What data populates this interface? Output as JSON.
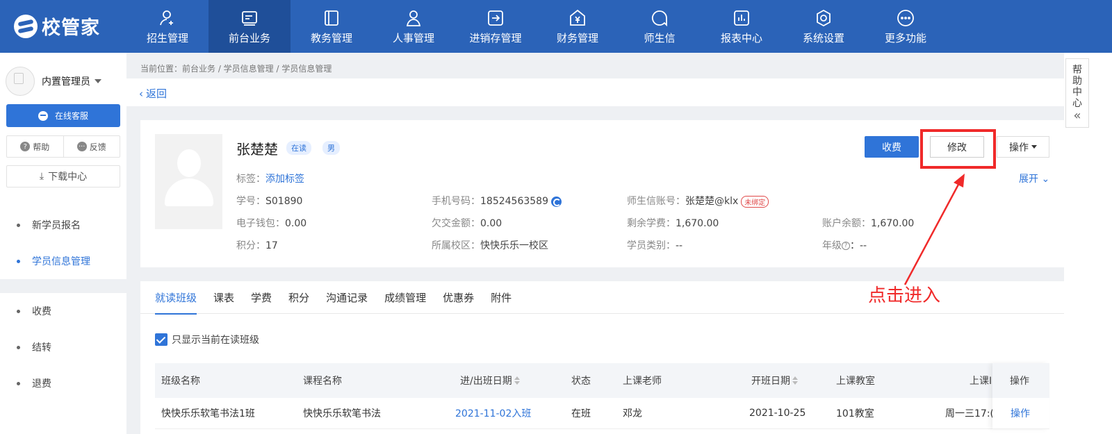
{
  "brand": {
    "name": "校管家"
  },
  "nav": [
    {
      "label": "招生管理",
      "icon": "user-add-icon"
    },
    {
      "label": "前台业务",
      "icon": "desk-icon"
    },
    {
      "label": "教务管理",
      "icon": "book-icon"
    },
    {
      "label": "人事管理",
      "icon": "person-icon"
    },
    {
      "label": "进销存管理",
      "icon": "inventory-icon"
    },
    {
      "label": "财务管理",
      "icon": "finance-icon"
    },
    {
      "label": "师生信",
      "icon": "chat-icon"
    },
    {
      "label": "报表中心",
      "icon": "report-icon"
    },
    {
      "label": "系统设置",
      "icon": "settings-icon"
    },
    {
      "label": "更多功能",
      "icon": "more-icon"
    }
  ],
  "sidebar": {
    "user": "内置管理员",
    "online_service": "在线客服",
    "help": "帮助",
    "feedback": "反馈",
    "download": "下载中心",
    "items": [
      {
        "label": "新学员报名"
      },
      {
        "label": "学员信息管理"
      },
      {
        "label": "收费"
      },
      {
        "label": "结转"
      },
      {
        "label": "退费"
      }
    ]
  },
  "breadcrumb": "当前位置：前台业务 / 学员信息管理 / 学员信息管理",
  "back": "返回",
  "student": {
    "name": "张楚楚",
    "status": "在读",
    "gender": "男",
    "tag_label": "标签：",
    "tag_link": "添加标签",
    "fields": {
      "id_label": "学号：",
      "id": "S01890",
      "phone_label": "手机号码：",
      "phone": "18524563589",
      "account_label": "师生信账号：",
      "account": "张楚楚@klx",
      "unbound": "未绑定",
      "wallet_label": "电子钱包：",
      "wallet": "0.00",
      "owed_label": "欠交金额：",
      "owed": "0.00",
      "remain_label": "剩余学费：",
      "remain": "1,670.00",
      "balance_label": "账户余额：",
      "balance": "1,670.00",
      "points_label": "积分：",
      "points": "17",
      "campus_label": "所属校区：",
      "campus": "快快乐乐一校区",
      "category_label": "学员类别：",
      "category": "--",
      "grade_label": "年级",
      "grade": "：--"
    },
    "buttons": {
      "pay": "收费",
      "edit": "修改",
      "ops": "操作",
      "expand": "展开"
    }
  },
  "tabs": [
    "就读班级",
    "课表",
    "学费",
    "积分",
    "沟通记录",
    "成绩管理",
    "优惠券",
    "附件"
  ],
  "filter": {
    "current_only": "只显示当前在读班级"
  },
  "table": {
    "headers": [
      "班级名称",
      "课程名称",
      "进/出班日期",
      "状态",
      "上课老师",
      "开班日期",
      "上课教室",
      "上课I",
      "操作"
    ],
    "rows": [
      [
        "快快乐乐软笔书法1班",
        "快快乐乐软笔书法",
        "2021-11-02入班",
        "在班",
        "邓龙",
        "2021-10-25",
        "101教室",
        "周一三17:(",
        "操作"
      ]
    ]
  },
  "annotation": "点击进入",
  "help_center": [
    "帮",
    "助",
    "中",
    "心"
  ],
  "colors": {
    "primary": "#2f74d8",
    "topbar": "#2b63b8",
    "highlight": "#f02a2a"
  }
}
